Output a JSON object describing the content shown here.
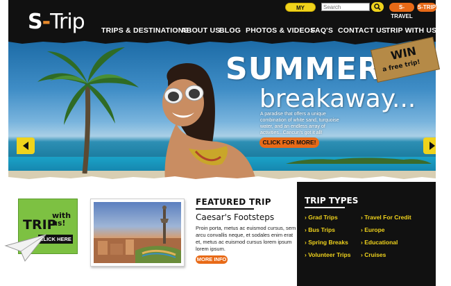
{
  "header": {
    "logo": {
      "s": "S",
      "dash": "-",
      "trip": "Trip"
    },
    "utility": {
      "profile_label": "MY PROFILE",
      "search_placeholder": "Search",
      "stravel_label": "S-TRAVEL",
      "strip_label": "S-TRIP"
    },
    "nav": [
      "TRIPS & DESTINATIONS",
      "ABOUT US",
      "BLOG",
      "PHOTOS & VIDEOS",
      "FAQ'S",
      "CONTACT US",
      "TRIP WITH US"
    ]
  },
  "hero": {
    "headline": "SUMMER",
    "subheadline": "breakaway...",
    "description": "A paradise that offers a unique combination of white sand, turquoise water, and an endless array of activities...Cancun's got it all!",
    "cta_label": "CLICK FOR MORE!",
    "win_tag": {
      "win": "WIN",
      "free": "a free trip!"
    }
  },
  "promo": {
    "trip": "TRIP",
    "with_us": [
      "with",
      "us!"
    ],
    "click_here": "CLICK HERE"
  },
  "featured": {
    "heading": "FEATURED TRIP",
    "title": "Caesar's Footsteps",
    "description": "Proin porta, metus ac euismod cursus, sem arcu convallis neque, et sodales enim erat et, metus ac euismod cursus lorem ipsum lorem ipsum.",
    "more_info": "MORE INFO"
  },
  "trip_types": {
    "heading": "TRIP TYPES",
    "items": [
      "Grad Trips",
      "Travel For Credit",
      "Bus Trips",
      "Europe",
      "Spring Breaks",
      "Educational",
      "Volunteer Trips",
      "Cruises"
    ]
  },
  "colors": {
    "accent_orange": "#e86a17",
    "accent_yellow": "#f0d31c",
    "promo_green": "#7dc142",
    "dark": "#111111"
  }
}
